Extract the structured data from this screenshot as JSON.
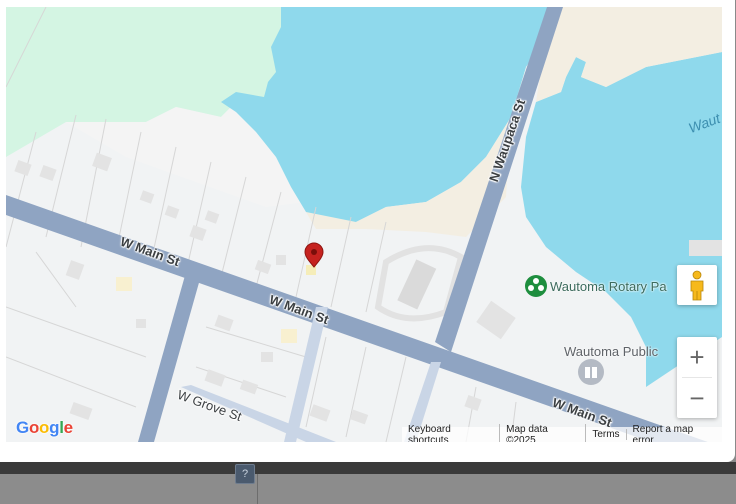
{
  "map": {
    "roads": {
      "w_main_st_west": "W Main St",
      "w_main_st_center": "W Main St",
      "w_main_st_east": "W Main St",
      "n_waupaca_st": "N Waupaca St",
      "w_grove_st": "W Grove St"
    },
    "pois": {
      "rotary_park": "Wautoma Rotary Pa",
      "public_library": "Wautoma Public"
    },
    "water_label": "Waut",
    "marker_icon": "red-map-pin-icon",
    "colors": {
      "water": "#8fd9ec",
      "park": "#d4f5e3",
      "road": "#8fa4c2",
      "land": "#f1f3f4",
      "sand": "#f3eee2",
      "marker": "#c5221f"
    }
  },
  "attribution": {
    "keyboard_shortcuts": "Keyboard shortcuts",
    "map_data": "Map data ©2025",
    "terms": "Terms",
    "report": "Report a map error"
  },
  "controls": {
    "pegman_icon": "pegman-icon",
    "zoom_in": "+",
    "zoom_out": "−"
  },
  "footer": {
    "help_label": "?"
  }
}
